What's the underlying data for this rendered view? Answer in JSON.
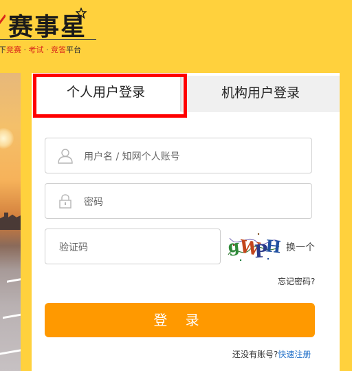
{
  "brand": {
    "logo_text": "赛事星",
    "slogan_prefix": "下",
    "slogan_item1": "竞赛",
    "slogan_sep1": "·",
    "slogan_item2": "考试",
    "slogan_sep2": "·",
    "slogan_item3": "竞答",
    "slogan_suffix": "平台",
    "accent_color": "#d9261c",
    "header_color": "#ffd13d"
  },
  "tabs": {
    "personal": "个人用户登录",
    "organization": "机构用户登录",
    "active": "personal"
  },
  "form": {
    "username_placeholder": "用户名 / 知网个人账号",
    "username_icon": "user-icon",
    "password_placeholder": "密码",
    "password_icon": "lock-icon",
    "captcha_placeholder": "验证码",
    "captcha_image_text": "gWPH",
    "change_captcha": "换一个",
    "forgot_password": "忘记密码?",
    "login_button": "登 录",
    "login_button_color": "#ff9900",
    "no_account": "还没有账号?",
    "register_link": "快速注册",
    "link_color": "#1e6ec8"
  },
  "highlight_color": "#ff0000"
}
